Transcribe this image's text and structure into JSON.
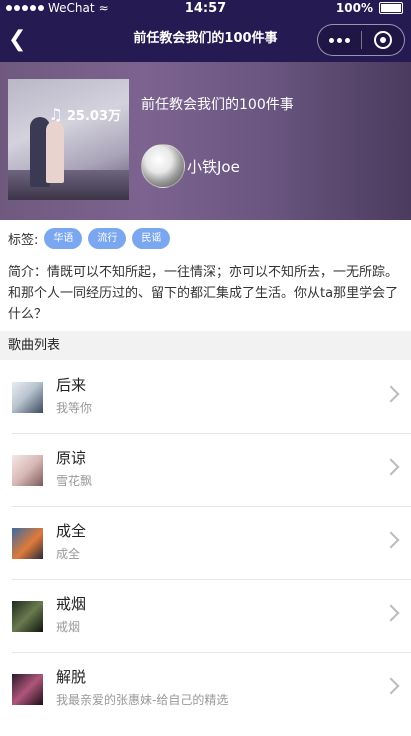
{
  "status_bar": {
    "carrier": "WeChat",
    "time": "14:57",
    "battery": "100%",
    "battery_level": 1.0
  },
  "nav": {
    "title": "前任教会我们的100件事"
  },
  "playlist": {
    "title": "前任教会我们的100件事",
    "play_count": "25.03万",
    "creator": "小铁Joe",
    "tags_label": "标签:",
    "tags": [
      "华语",
      "流行",
      "民谣"
    ],
    "description": "简介：情既可以不知所起，一往情深；亦可以不知所去，一无所踪。和那个人一同经历过的、留下的都汇集成了生活。你从ta那里学会了什么？"
  },
  "song_list": {
    "title": "歌曲列表",
    "songs": [
      {
        "name": "后来",
        "artist": "我等你"
      },
      {
        "name": "原谅",
        "artist": "雪花飘"
      },
      {
        "name": "成全",
        "artist": "成全"
      },
      {
        "name": "戒烟",
        "artist": "戒烟"
      },
      {
        "name": "解脱",
        "artist": "我最亲爱的张惠妹-给自己的精选"
      }
    ]
  },
  "colors": {
    "nav_bg": "#251a52",
    "tag_bg": "#7aa7ef"
  }
}
